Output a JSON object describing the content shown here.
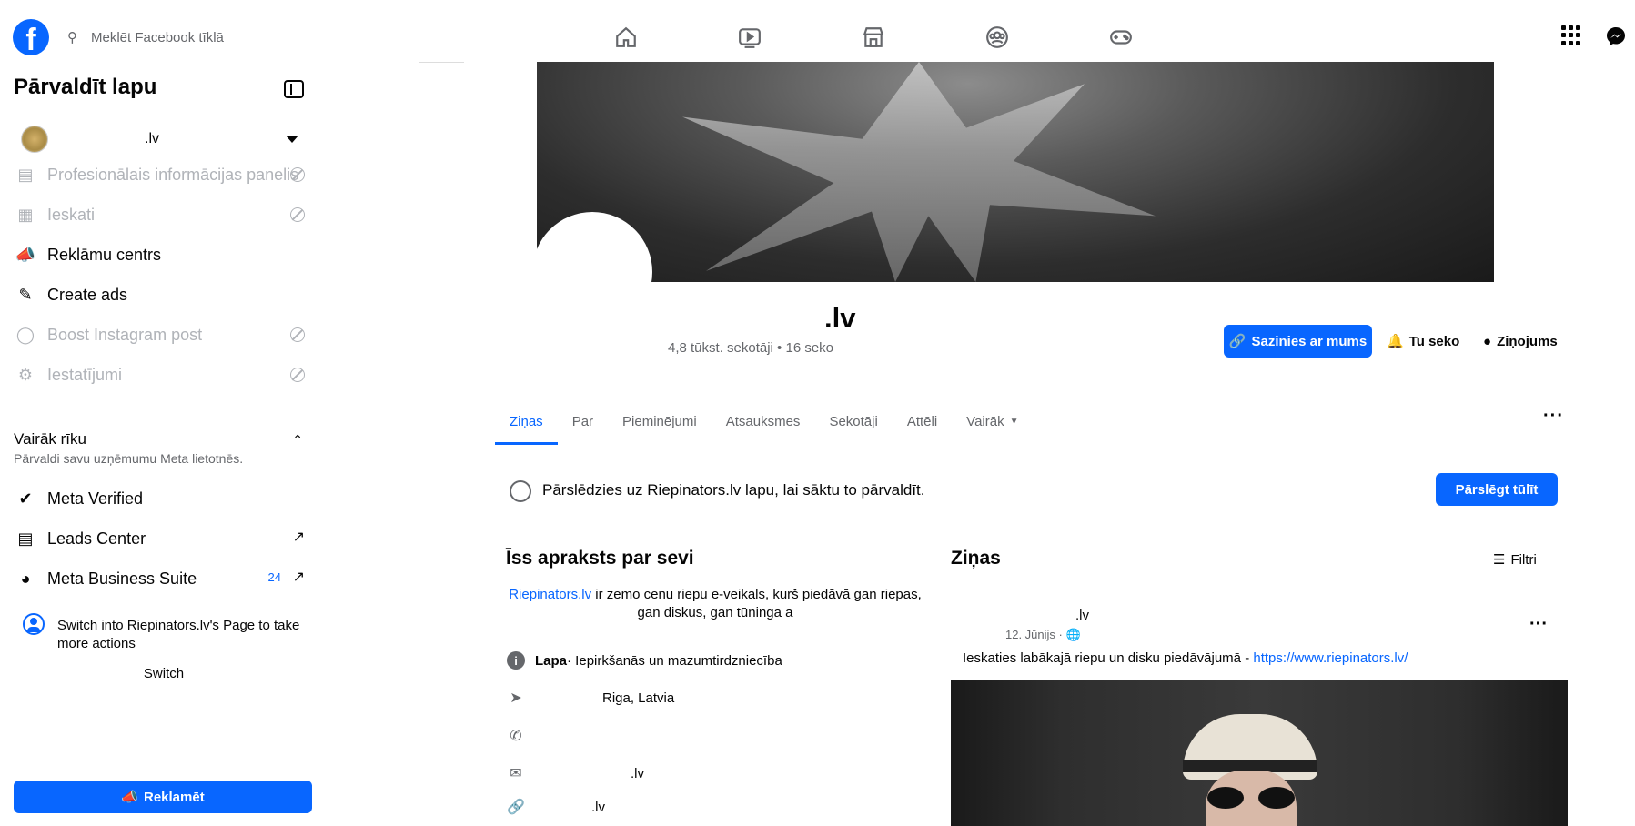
{
  "topbar": {
    "search_placeholder": "Meklēt Facebook tīklā",
    "nav_icons": [
      "home-icon",
      "video-icon",
      "marketplace-icon",
      "groups-icon",
      "gaming-icon"
    ]
  },
  "sidebar": {
    "title": "Pārvaldīt lapu",
    "page_name": ".lv",
    "items": [
      {
        "label": "Profesionālais informācijas panelis",
        "disabled": true
      },
      {
        "label": "Ieskati",
        "disabled": true
      },
      {
        "label": "Reklāmu centrs",
        "disabled": false
      },
      {
        "label": "Create ads",
        "disabled": false
      },
      {
        "label": "Boost Instagram post",
        "disabled": true
      },
      {
        "label": "Iestatījumi",
        "disabled": true
      }
    ],
    "more_tools": {
      "heading": "Vairāk rīku",
      "subheading": "Pārvaldi savu uzņēmumu Meta lietotnēs."
    },
    "tools": [
      {
        "label": "Meta Verified"
      },
      {
        "label": "Leads Center"
      },
      {
        "label": "Meta Business Suite",
        "badge": "24"
      }
    ],
    "switch_card": {
      "text": "Switch into Riepinators.lv's Page to take more actions",
      "button": "Switch"
    },
    "promote_button": "Reklamēt"
  },
  "profile": {
    "name": ".lv",
    "meta": "4,8 tūkst. sekotāji • 16 seko",
    "contact_button": "Sazinies ar mums",
    "follow_button": "Tu seko",
    "message_button": "Ziņojums"
  },
  "tabs": [
    "Ziņas",
    "Par",
    "Pieminējumi",
    "Atsauksmes",
    "Sekotāji",
    "Attēli",
    "Vairāk"
  ],
  "notice": {
    "text": "Pārslēdzies uz Riepinators.lv lapu, lai sāktu to pārvaldīt.",
    "button": "Pārslēgt tūlīt"
  },
  "intro": {
    "heading": "Īss apraksts par sevi",
    "bio_link": "Riepinators.lv",
    "bio_text": " ir zemo cenu riepu e-veikals, kurš piedāvā gan riepas, gan diskus, gan tūninga a",
    "category_label": "Lapa",
    "category_value": " · Iepirkšanās un mazumtirdzniecība",
    "location": "Riga, Latvia",
    "email": ".lv",
    "website": ".lv"
  },
  "posts": {
    "heading": "Ziņas",
    "filters": "Filtri",
    "author": ".lv",
    "date": "12. Jūnijs ·",
    "text": "Ieskaties labākajā riepu un disku piedāvājumā - ",
    "link": "https://www.riepinators.lv/"
  },
  "colors": {
    "accent": "#0866ff",
    "secondary_text": "#65676b",
    "disabled_text": "#b0b3b8"
  }
}
